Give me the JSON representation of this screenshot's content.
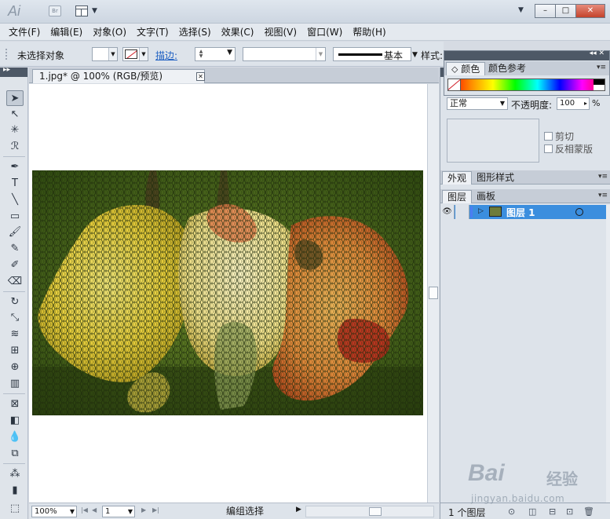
{
  "titlebar": {
    "app_logo": "Ai",
    "bridge_label": "Br",
    "window_controls": [
      "–",
      "□",
      "✕"
    ]
  },
  "menu": [
    "文件(F)",
    "编辑(E)",
    "对象(O)",
    "文字(T)",
    "选择(S)",
    "效果(C)",
    "视图(V)",
    "窗口(W)",
    "帮助(H)"
  ],
  "controlbar": {
    "selection_status": "未选择对象",
    "stroke_label": "描边:",
    "brush_label": "基本",
    "style_label": "样式:"
  },
  "document": {
    "tab_title": "1.jpg* @ 100% (RGB/预览)",
    "close_glyph": "✕",
    "zoom": "100%",
    "page": "1",
    "status": "编组选择"
  },
  "color_panel": {
    "tabs": [
      "颜色",
      "颜色参考"
    ]
  },
  "transparency_panel": {
    "blend_mode": "正常",
    "opacity_label": "不透明度:",
    "opacity_value": "100",
    "opacity_unit": "%",
    "clip_label": "剪切",
    "invert_mask_label": "反相蒙版"
  },
  "appearance_panel": {
    "tabs": [
      "外观",
      "图形样式"
    ]
  },
  "layers_panel": {
    "tabs": [
      "图层",
      "画板"
    ],
    "layers": [
      {
        "name": "图层 1",
        "selected": true,
        "visible": true
      }
    ],
    "count_label": "1 个图层"
  },
  "watermark": {
    "logo": "Bai",
    "cn": "经验",
    "url": "jingyan.baidu.com"
  },
  "colors": {
    "selection_blue": "#3b8ede",
    "panel_header": "#4d5866",
    "close_button": "#c4432c",
    "stroke_link": "#1d5fc2"
  }
}
